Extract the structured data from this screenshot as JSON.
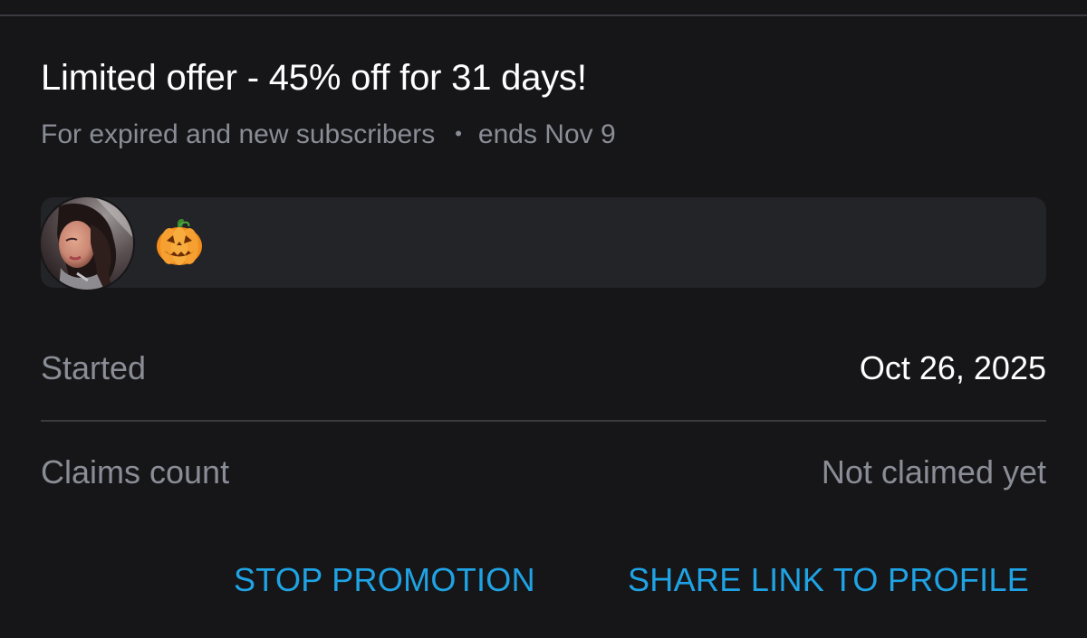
{
  "promotion": {
    "title": "Limited offer - 45% off for 31 days!",
    "audience": "For expired and new subscribers",
    "separator": "•",
    "ends": "ends Nov 9",
    "message": {
      "avatar_icon": "avatar-photo",
      "emoji_icon": "jack-o-lantern-emoji"
    }
  },
  "details": {
    "started_label": "Started",
    "started_value": "Oct 26, 2025",
    "claims_label": "Claims count",
    "claims_value": "Not claimed yet"
  },
  "actions": {
    "stop_label": "STOP PROMOTION",
    "share_label": "SHARE LINK TO PROFILE"
  },
  "colors": {
    "background": "#161618",
    "accent": "#1fa3e4",
    "secondary_text": "#8a8d96",
    "card": "#232428",
    "divider": "#3a3b40"
  }
}
